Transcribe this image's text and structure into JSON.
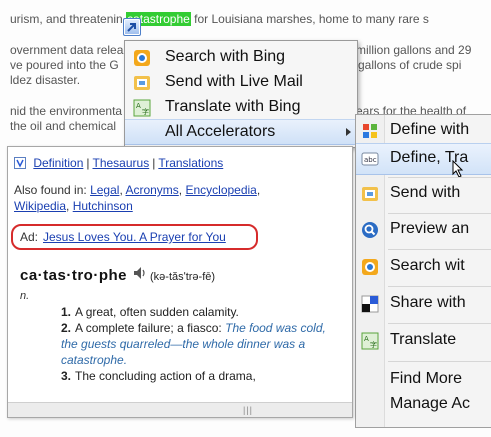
{
  "article": {
    "line1_before": "urism, and threatenin",
    "line1_highlight": "catastrophe",
    "line1_after": "for Louisiana marshes, home to many rare s",
    "line2_left": "overnment data relea",
    "line2_right": "million gallons and 29",
    "line3_left": "ve poured into the G",
    "line3_right": "gallons of crude spi",
    "line4_left": "ldez disaster.",
    "line5_left": "nid the environmenta",
    "line5_right": "ears for the health of",
    "line6_left": "the oil and chemical"
  },
  "menu": {
    "items": [
      {
        "label": "Search with Bing",
        "icon": "bing-icon"
      },
      {
        "label": "Send with Live Mail",
        "icon": "live-mail-icon"
      },
      {
        "label": "Translate with Bing",
        "icon": "translate-icon"
      },
      {
        "label": "All Accelerators",
        "icon": ""
      }
    ]
  },
  "submenu": {
    "items": [
      {
        "label": "Define with",
        "icon": "windows-flag-icon"
      },
      {
        "label": "Define, Tra",
        "icon": "dictionary-icon"
      },
      {
        "label": "Send with",
        "icon": "live-mail-icon"
      },
      {
        "label": "Preview an",
        "icon": "magnifier-icon"
      },
      {
        "label": "Search wit",
        "icon": "bing-icon"
      },
      {
        "label": "Share with",
        "icon": "share-icon"
      },
      {
        "label": "Translate",
        "icon": "translate-icon"
      }
    ],
    "find_more": "Find More",
    "manage": "Manage Ac"
  },
  "preview": {
    "links": {
      "definition": "Definition",
      "thesaurus": "Thesaurus",
      "translations": "Translations"
    },
    "also_found_label": "Also found in:",
    "also_found": [
      "Legal",
      "Acronyms",
      "Encyclopedia",
      "Wikipedia",
      "Hutchinson"
    ],
    "ad_label": "Ad:",
    "ad_link": "Jesus Loves You. A Prayer for You",
    "headword": "ca·tas·tro·phe",
    "pronunciation": "(kə-tăsʹtrə-fē)",
    "pos": "n.",
    "definitions": [
      {
        "num": "1.",
        "text": "A great, often sudden calamity."
      },
      {
        "num": "2.",
        "text": "A complete failure; a fiasco:",
        "example": "The food was cold, the guests quarreled—the whole dinner was a catastrophe."
      },
      {
        "num": "3.",
        "text": "The concluding action of a drama,"
      }
    ]
  },
  "colors": {
    "highlight": "#33cc33",
    "link": "#1a3fb1",
    "ad_border": "#d62b2b",
    "selection": "#d2e3f8"
  }
}
